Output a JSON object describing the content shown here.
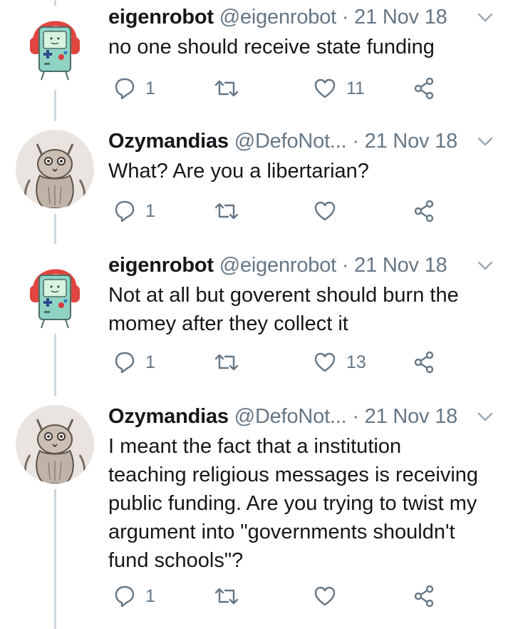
{
  "colors": {
    "text": "#14171a",
    "muted": "#657786",
    "thread_line": "#ccd6dd",
    "icon": "#657786"
  },
  "tweets": [
    {
      "name": "eigenrobot",
      "handle": "@eigenrobot",
      "date": "· 21 Nov 18",
      "avatar": "bmo-headphones-avatar",
      "lines": [
        "no one should receive state funding"
      ],
      "reply_count": "1",
      "like_count": "11"
    },
    {
      "name": "Ozymandias",
      "handle": "@DefoNot...",
      "date": "· 21 Nov 18",
      "avatar": "cat-drawing-avatar",
      "lines": [
        "What? Are you a libertarian?"
      ],
      "reply_count": "1",
      "like_count": ""
    },
    {
      "name": "eigenrobot",
      "handle": "@eigenrobot",
      "date": "· 21 Nov 18",
      "avatar": "bmo-headphones-avatar",
      "lines": [
        "Not at all but goverent should burn the",
        "momey after they collect it"
      ],
      "reply_count": "1",
      "like_count": "13"
    },
    {
      "name": "Ozymandias",
      "handle": "@DefoNot...",
      "date": "· 21 Nov 18",
      "avatar": "cat-drawing-avatar",
      "lines": [
        "I meant the fact that a institution",
        "teaching religious messages is receiving",
        "public funding. Are you trying to twist my",
        "argument into \"governments shouldn't",
        "fund schools\"?"
      ],
      "reply_count": "1",
      "like_count": ""
    }
  ]
}
